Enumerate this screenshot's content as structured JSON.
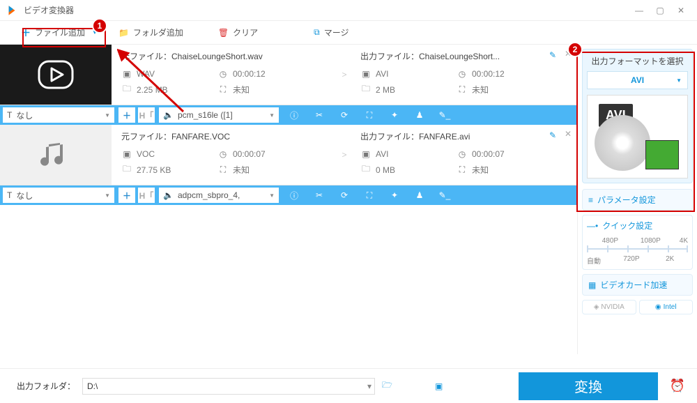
{
  "window": {
    "title": "ビデオ変換器"
  },
  "toolbar": {
    "add_file": "ファイル追加",
    "add_folder": "フォルダ追加",
    "clear": "クリア",
    "merge": "マージ"
  },
  "files": [
    {
      "source": {
        "label": "元ファイル：",
        "name": "ChaiseLoungeShort.wav",
        "format": "WAV",
        "duration": "00:00:12",
        "size": "2.25 MB",
        "dimension": "未知"
      },
      "output": {
        "label": "出力ファイル：",
        "name": "ChaiseLoungeShort...",
        "format": "AVI",
        "duration": "00:00:12",
        "size": "2 MB",
        "dimension": "未知"
      },
      "track_none": "なし",
      "codec": "pcm_s16le ([1]"
    },
    {
      "source": {
        "label": "元ファイル：",
        "name": "FANFARE.VOC",
        "format": "VOC",
        "duration": "00:00:07",
        "size": "27.75 KB",
        "dimension": "未知"
      },
      "output": {
        "label": "出力ファイル：",
        "name": "FANFARE.avi",
        "format": "AVI",
        "duration": "00:00:07",
        "size": "0 MB",
        "dimension": "未知"
      },
      "track_none": "なし",
      "codec": "adpcm_sbpro_4,"
    }
  ],
  "side": {
    "format_label": "出力フォーマットを選択",
    "format_value": "AVI",
    "format_badge": "AVI",
    "param_settings": "パラメータ設定",
    "quick_settings": "クイック設定",
    "quick_scale": {
      "auto": "自動",
      "p480": "480P",
      "p720": "720P",
      "p1080": "1080P",
      "k2": "2K",
      "k4": "4K"
    },
    "gpu_accel": "ビデオカード加速",
    "nvidia": "NVIDIA",
    "intel": "Intel"
  },
  "footer": {
    "out_label": "出力フォルダ：",
    "out_path": "D:\\",
    "convert": "変換"
  },
  "callouts": {
    "one": "1",
    "two": "2"
  }
}
